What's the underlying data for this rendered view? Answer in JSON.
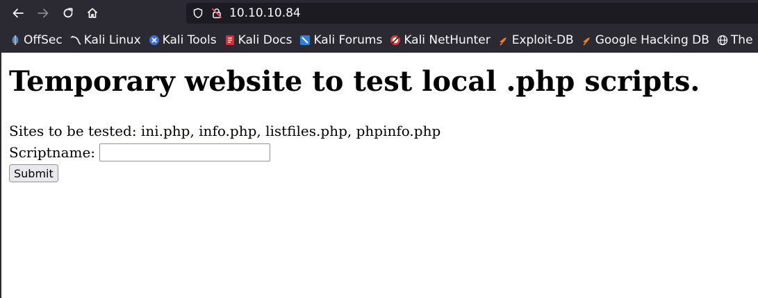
{
  "browser": {
    "url": "10.10.10.84",
    "nav_icons": [
      "back-arrow-icon",
      "forward-arrow-icon",
      "reload-icon",
      "home-icon"
    ],
    "bookmarks": [
      {
        "label": "OffSec",
        "icon": "offsec-icon"
      },
      {
        "label": "Kali Linux",
        "icon": "kali-dragon-icon"
      },
      {
        "label": "Kali Tools",
        "icon": "kali-tools-icon"
      },
      {
        "label": "Kali Docs",
        "icon": "kali-docs-icon"
      },
      {
        "label": "Kali Forums",
        "icon": "kali-forums-icon"
      },
      {
        "label": "Kali NetHunter",
        "icon": "kali-nethunter-icon"
      },
      {
        "label": "Exploit-DB",
        "icon": "exploit-db-icon"
      },
      {
        "label": "Google Hacking DB",
        "icon": "ghdb-icon"
      },
      {
        "label": "The",
        "icon": "globe-icon"
      }
    ]
  },
  "page": {
    "heading": "Temporary website to test local .php scripts.",
    "sites_line": "Sites to be tested: ini.php, info.php, listfiles.php, phpinfo.php",
    "script_label": "Scriptname:",
    "script_value": "",
    "submit_label": "Submit"
  },
  "colors": {
    "chrome_bg": "#2b2a33",
    "urlbar_bg": "#1c1b22",
    "page_bg": "#ffffff"
  }
}
